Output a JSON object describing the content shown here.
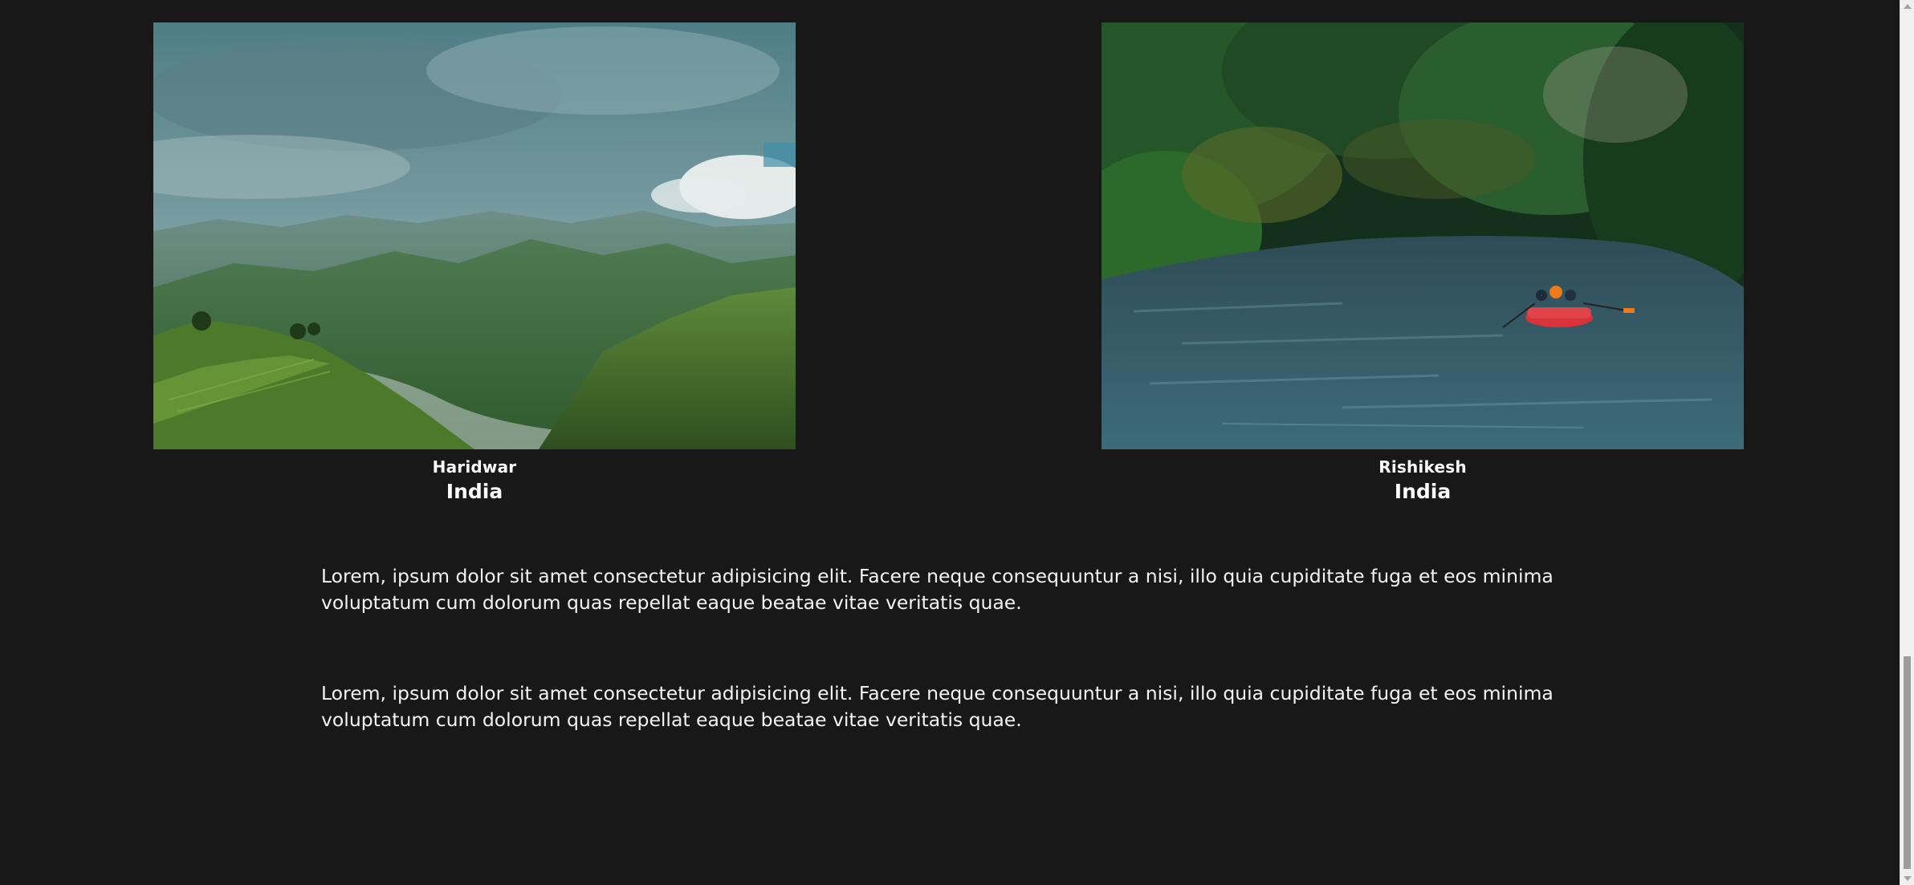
{
  "destinations": [
    {
      "city": "Haridwar",
      "country": "India",
      "image": "mountain-valley-photo"
    },
    {
      "city": "Rishikesh",
      "country": "India",
      "image": "river-rafting-photo"
    }
  ],
  "paragraphs": [
    "Lorem, ipsum dolor sit amet consectetur adipisicing elit. Facere neque consequuntur a nisi, illo quia cupiditate fuga et eos minima voluptatum cum dolorum quas repellat eaque beatae vitae veritatis quae.",
    "Lorem, ipsum dolor sit amet consectetur adipisicing elit. Facere neque consequuntur a nisi, illo quia cupiditate fuga et eos minima voluptatum cum dolorum quas repellat eaque beatae vitae veritatis quae."
  ],
  "colors": {
    "background": "#181818",
    "text": "#ffffff"
  }
}
